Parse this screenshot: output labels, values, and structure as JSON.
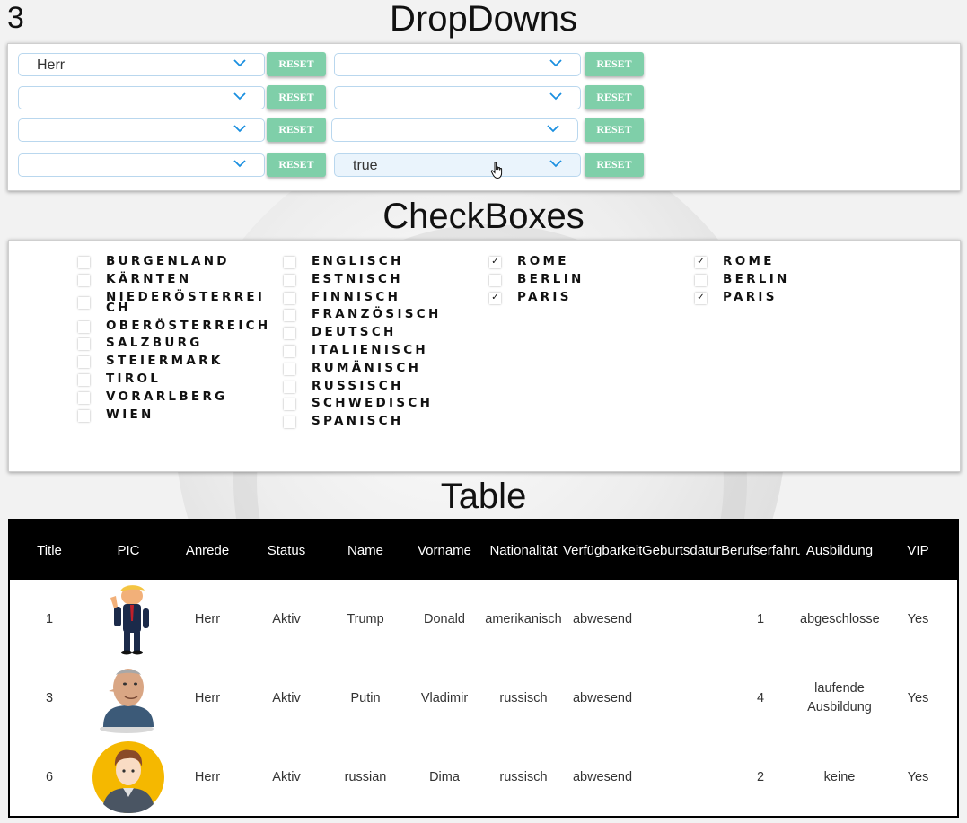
{
  "counter": "3",
  "dropdowns": {
    "title": "DropDowns",
    "reset_label": "RESET",
    "rows": [
      {
        "left": "Herr",
        "right": ""
      },
      {
        "left": "",
        "right": ""
      },
      {
        "left": "",
        "right": ""
      },
      {
        "left": "",
        "right": "true"
      }
    ]
  },
  "checkboxes": {
    "title": "CheckBoxes",
    "columns": [
      {
        "items": [
          {
            "label": "BURGENLAND",
            "checked": false
          },
          {
            "label": "KÄRNTEN",
            "checked": false
          },
          {
            "label": "NIEDERÖSTERREICH",
            "checked": false
          },
          {
            "label": "OBERÖSTERREICH",
            "checked": false
          },
          {
            "label": "SALZBURG",
            "checked": false
          },
          {
            "label": "STEIERMARK",
            "checked": false
          },
          {
            "label": "TIROL",
            "checked": false
          },
          {
            "label": "VORARLBERG",
            "checked": false
          },
          {
            "label": "WIEN",
            "checked": false
          }
        ]
      },
      {
        "items": [
          {
            "label": "ENGLISCH",
            "checked": false
          },
          {
            "label": "ESTNISCH",
            "checked": false
          },
          {
            "label": "FINNISCH",
            "checked": false
          },
          {
            "label": "FRANZÖSISCH",
            "checked": false
          },
          {
            "label": "DEUTSCH",
            "checked": false
          },
          {
            "label": "ITALIENISCH",
            "checked": false
          },
          {
            "label": "RUMÄNISCH",
            "checked": false
          },
          {
            "label": "RUSSISCH",
            "checked": false
          },
          {
            "label": "SCHWEDISCH",
            "checked": false
          },
          {
            "label": "SPANISCH",
            "checked": false
          }
        ]
      },
      {
        "items": [
          {
            "label": "ROME",
            "checked": true
          },
          {
            "label": "BERLIN",
            "checked": false
          },
          {
            "label": "PARIS",
            "checked": true
          }
        ]
      },
      {
        "items": [
          {
            "label": "ROME",
            "checked": true
          },
          {
            "label": "BERLIN",
            "checked": false
          },
          {
            "label": "PARIS",
            "checked": true
          }
        ]
      }
    ]
  },
  "table": {
    "title": "Table",
    "headers": [
      "Title",
      "PIC",
      "Anrede",
      "Status",
      "Name",
      "Vorname",
      "Nationalität",
      "Verfügbarkeit",
      "Geburtsdatum",
      "Berufserfahrung",
      "Ausbildung",
      "VIP"
    ],
    "rows": [
      {
        "title": "1",
        "pic": "trump-caricature",
        "anrede": "Herr",
        "status": "Aktiv",
        "name": "Trump",
        "vorname": "Donald",
        "nationalitaet": "amerikanisch",
        "verfuegbarkeit": "abwesend",
        "geburtsdatum": "",
        "berufserfahrung": "1",
        "ausbildung": "abgeschlossen",
        "vip": "Yes"
      },
      {
        "title": "3",
        "pic": "putin-caricature",
        "anrede": "Herr",
        "status": "Aktiv",
        "name": "Putin",
        "vorname": "Vladimir",
        "nationalitaet": "russisch",
        "verfuegbarkeit": "abwesend",
        "geburtsdatum": "",
        "berufserfahrung": "4",
        "ausbildung": "laufende Ausbildung",
        "vip": "Yes"
      },
      {
        "title": "6",
        "pic": "avatar-placeholder",
        "anrede": "Herr",
        "status": "Aktiv",
        "name": "russian",
        "vorname": "Dima",
        "nationalitaet": "russisch",
        "verfuegbarkeit": "abwesend",
        "geburtsdatum": "",
        "berufserfahrung": "2",
        "ausbildung": "keine",
        "vip": "Yes"
      }
    ]
  },
  "colors": {
    "reset_button": "#7fcfa9",
    "chevron": "#1a8fe0",
    "table_header_bg": "#000000",
    "avatar_bg": "#f5b800"
  }
}
